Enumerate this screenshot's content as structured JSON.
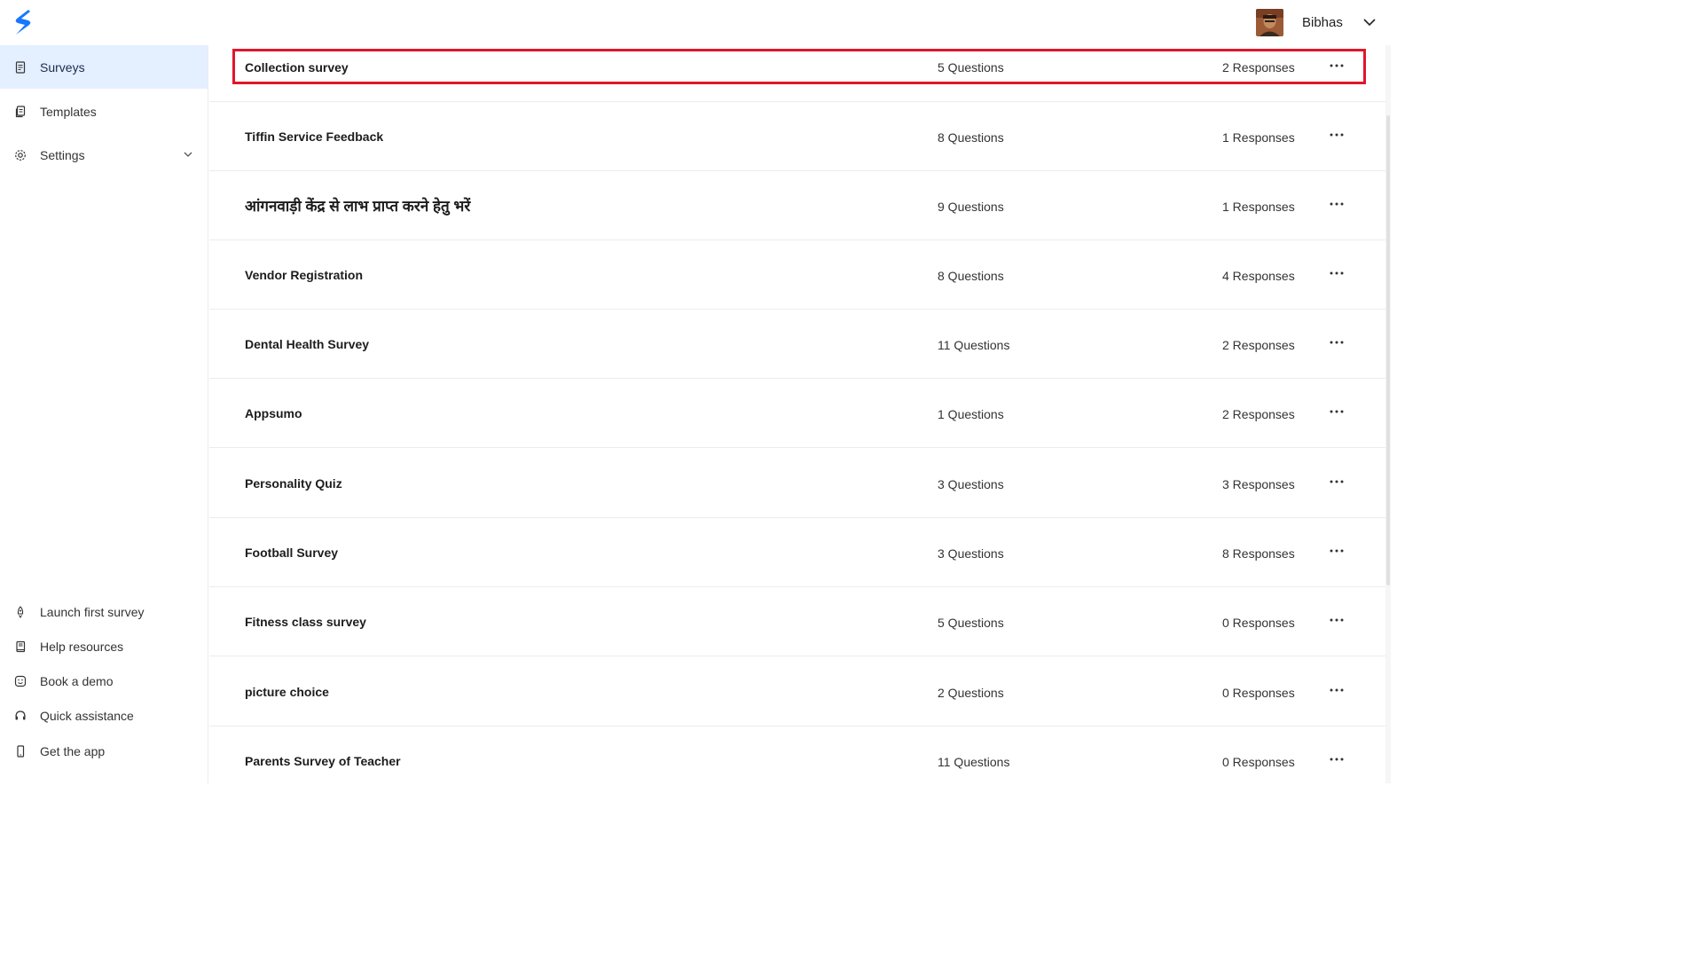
{
  "header": {
    "logo_icon": "brand-s-logo-icon",
    "brand_color": "#1677ff",
    "username": "Bibhas",
    "chevron_icon": "chevron-down-icon"
  },
  "sidebar": {
    "items": [
      {
        "label": "Surveys",
        "icon": "survey-doc-icon",
        "active": true
      },
      {
        "label": "Templates",
        "icon": "template-icon",
        "active": false
      },
      {
        "label": "Settings",
        "icon": "gear-icon",
        "active": false,
        "expandable": true
      }
    ],
    "bottom_items": [
      {
        "label": "Launch first survey",
        "icon": "rocket-icon"
      },
      {
        "label": "Help resources",
        "icon": "book-icon"
      },
      {
        "label": "Book a demo",
        "icon": "smiley-icon"
      },
      {
        "label": "Quick assistance",
        "icon": "headset-icon"
      },
      {
        "label": "Get the app",
        "icon": "phone-icon"
      }
    ],
    "active_bg": "#e4efff"
  },
  "surveys": [
    {
      "name": "Collection survey",
      "questions": "5 Questions",
      "responses": "2 Responses",
      "highlighted": true
    },
    {
      "name": "Tiffin Service Feedback",
      "questions": "8 Questions",
      "responses": "1 Responses"
    },
    {
      "name": "आंगनवाड़ी केंद्र से लाभ प्राप्त करने हेतु भरें",
      "questions": "9 Questions",
      "responses": "1 Responses"
    },
    {
      "name": "Vendor Registration",
      "questions": "8 Questions",
      "responses": "4 Responses"
    },
    {
      "name": "Dental Health Survey",
      "questions": "11 Questions",
      "responses": "2 Responses"
    },
    {
      "name": "Appsumo",
      "questions": "1 Questions",
      "responses": "2 Responses"
    },
    {
      "name": "Personality Quiz",
      "questions": "3 Questions",
      "responses": "3 Responses"
    },
    {
      "name": "Football Survey",
      "questions": "3 Questions",
      "responses": "8 Responses"
    },
    {
      "name": "Fitness class survey",
      "questions": "5 Questions",
      "responses": "0 Responses"
    },
    {
      "name": "picture choice",
      "questions": "2 Questions",
      "responses": "0 Responses"
    },
    {
      "name": "Parents Survey of Teacher",
      "questions": "11 Questions",
      "responses": "0 Responses"
    }
  ],
  "row_more_icon": "more-horizontal-icon",
  "highlight_color": "#e0162b"
}
